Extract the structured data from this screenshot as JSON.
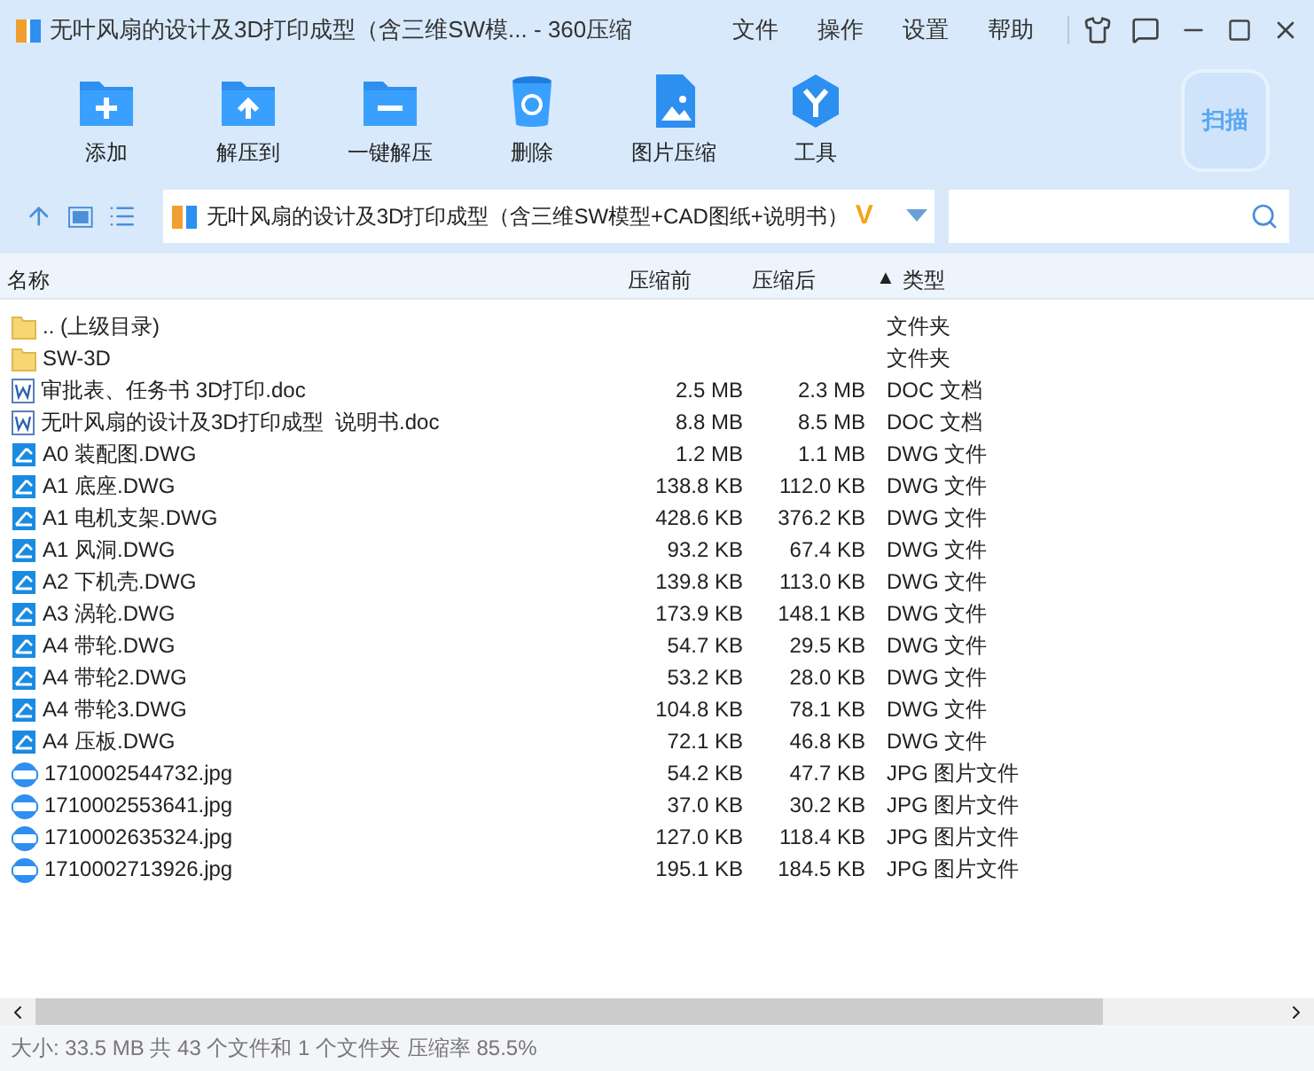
{
  "window": {
    "title": "无叶风扇的设计及3D打印成型（含三维SW模... - 360压缩"
  },
  "menu": [
    "文件",
    "操作",
    "设置",
    "帮助"
  ],
  "toolbar": [
    {
      "label": "添加",
      "kind": "add"
    },
    {
      "label": "解压到",
      "kind": "extract"
    },
    {
      "label": "一键解压",
      "kind": "quick"
    },
    {
      "label": "删除",
      "kind": "delete"
    },
    {
      "label": "图片压缩",
      "kind": "image"
    },
    {
      "label": "工具",
      "kind": "tools"
    }
  ],
  "scan_button": "扫描",
  "address": {
    "path": "无叶风扇的设计及3D打印成型（含三维SW模型+CAD图纸+说明书）",
    "badge": "V"
  },
  "table": {
    "columns": [
      "名称",
      "压缩前",
      "压缩后",
      "类型"
    ],
    "sort_mark": "▲",
    "rows": [
      {
        "kind": "folder",
        "name": ".. (上级目录)",
        "before": "",
        "after": "",
        "type": "文件夹"
      },
      {
        "kind": "folder",
        "name": "SW-3D",
        "before": "",
        "after": "",
        "type": "文件夹"
      },
      {
        "kind": "doc",
        "name": "审批表、任务书 3D打印.doc",
        "before": "2.5 MB",
        "after": "2.3 MB",
        "type": "DOC 文档"
      },
      {
        "kind": "doc",
        "name": "无叶风扇的设计及3D打印成型  说明书.doc",
        "before": "8.8 MB",
        "after": "8.5 MB",
        "type": "DOC 文档"
      },
      {
        "kind": "dwg",
        "name": "A0 装配图.DWG",
        "before": "1.2 MB",
        "after": "1.1 MB",
        "type": "DWG 文件"
      },
      {
        "kind": "dwg",
        "name": "A1 底座.DWG",
        "before": "138.8 KB",
        "after": "112.0 KB",
        "type": "DWG 文件"
      },
      {
        "kind": "dwg",
        "name": "A1 电机支架.DWG",
        "before": "428.6 KB",
        "after": "376.2 KB",
        "type": "DWG 文件"
      },
      {
        "kind": "dwg",
        "name": "A1 风洞.DWG",
        "before": "93.2 KB",
        "after": "67.4 KB",
        "type": "DWG 文件"
      },
      {
        "kind": "dwg",
        "name": "A2 下机壳.DWG",
        "before": "139.8 KB",
        "after": "113.0 KB",
        "type": "DWG 文件"
      },
      {
        "kind": "dwg",
        "name": "A3 涡轮.DWG",
        "before": "173.9 KB",
        "after": "148.1 KB",
        "type": "DWG 文件"
      },
      {
        "kind": "dwg",
        "name": "A4 带轮.DWG",
        "before": "54.7 KB",
        "after": "29.5 KB",
        "type": "DWG 文件"
      },
      {
        "kind": "dwg",
        "name": "A4 带轮2.DWG",
        "before": "53.2 KB",
        "after": "28.0 KB",
        "type": "DWG 文件"
      },
      {
        "kind": "dwg",
        "name": "A4 带轮3.DWG",
        "before": "104.8 KB",
        "after": "78.1 KB",
        "type": "DWG 文件"
      },
      {
        "kind": "dwg",
        "name": "A4 压板.DWG",
        "before": "72.1 KB",
        "after": "46.8 KB",
        "type": "DWG 文件"
      },
      {
        "kind": "jpg",
        "name": "1710002544732.jpg",
        "before": "54.2 KB",
        "after": "47.7 KB",
        "type": "JPG 图片文件"
      },
      {
        "kind": "jpg",
        "name": "1710002553641.jpg",
        "before": "37.0 KB",
        "after": "30.2 KB",
        "type": "JPG 图片文件"
      },
      {
        "kind": "jpg",
        "name": "1710002635324.jpg",
        "before": "127.0 KB",
        "after": "118.4 KB",
        "type": "JPG 图片文件"
      },
      {
        "kind": "jpg",
        "name": "1710002713926.jpg",
        "before": "195.1 KB",
        "after": "184.5 KB",
        "type": "JPG 图片文件"
      }
    ]
  },
  "status_bar": "大小: 33.5 MB 共 43 个文件和 1 个文件夹 压缩率 85.5%"
}
